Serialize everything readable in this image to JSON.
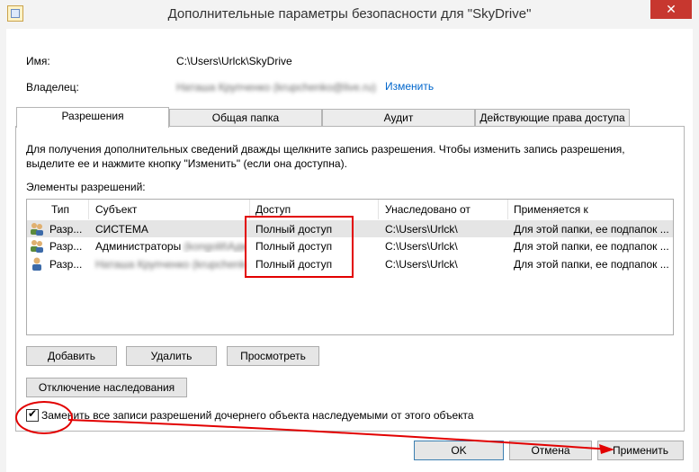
{
  "window": {
    "title": "Дополнительные параметры безопасности  для \"SkyDrive\"",
    "close_glyph": "✕"
  },
  "properties": {
    "name_label": "Имя:",
    "name_value": "C:\\Users\\Urlck\\SkyDrive",
    "owner_label": "Владелец:",
    "owner_value": "Наташа Крупченко (krupchenko@live.ru)",
    "change_link": "Изменить"
  },
  "tabs": [
    {
      "label": "Разрешения",
      "active": true
    },
    {
      "label": "Общая папка"
    },
    {
      "label": "Аудит"
    },
    {
      "label": "Действующие права доступа"
    }
  ],
  "panel": {
    "description": "Для получения дополнительных сведений дважды щелкните запись разрешения. Чтобы изменить запись разрешения, выделите ее и нажмите кнопку \"Изменить\" (если она доступна).",
    "list_label": "Элементы разрешений:"
  },
  "table": {
    "columns": [
      "Тип",
      "Субъект",
      "Доступ",
      "Унаследовано от",
      "Применяется к"
    ],
    "rows": [
      {
        "type": "Разр...",
        "subject": "СИСТЕМА",
        "subject_blur": "",
        "access": "Полный доступ",
        "inherited": "C:\\Users\\Urlck\\",
        "applies": "Для этой папки, ее подпапок ..."
      },
      {
        "type": "Разр...",
        "subject": "Администраторы",
        "subject_blur": "(kongolit\\Админ...)",
        "access": "Полный доступ",
        "inherited": "C:\\Users\\Urlck\\",
        "applies": "Для этой папки, ее подпапок ..."
      },
      {
        "type": "Разр...",
        "subject": "",
        "subject_blur": "Наташа Крупченко (krupchenko...)",
        "access": "Полный доступ",
        "inherited": "C:\\Users\\Urlck\\",
        "applies": "Для этой папки, ее подпапок ..."
      }
    ]
  },
  "buttons": {
    "add": "Добавить",
    "remove": "Удалить",
    "view": "Просмотреть",
    "disable_inheritance": "Отключение наследования",
    "ok": "OK",
    "cancel": "Отмена",
    "apply": "Применить"
  },
  "checkbox": {
    "label": "Заменить все записи разрешений дочернего объекта наследуемыми от этого объекта",
    "checked": true,
    "check_glyph": "✔"
  },
  "colors": {
    "annotation": "#e20000",
    "link": "#0066cc"
  }
}
